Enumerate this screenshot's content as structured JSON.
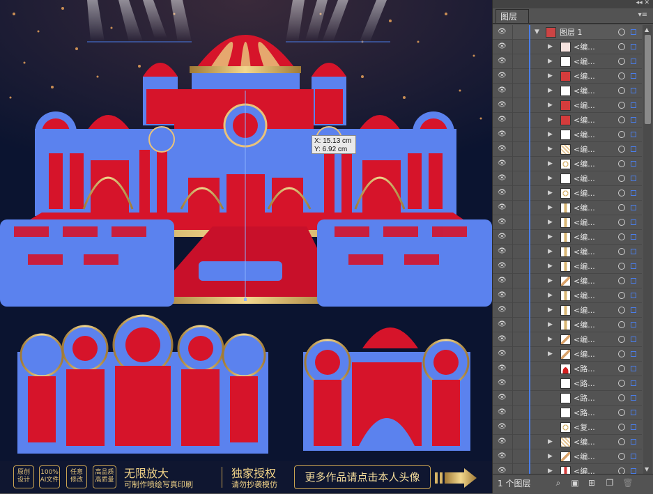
{
  "tooltip": {
    "x": "X: 15.13 cm",
    "y": "Y: 6.92 cm"
  },
  "banner": {
    "badges": [
      {
        "line1": "原创",
        "line2": "设计"
      },
      {
        "line1": "100%",
        "line2": "AI文件"
      },
      {
        "line1": "任意",
        "line2": "修改"
      },
      {
        "line1": "高品质",
        "line2": "高质量"
      }
    ],
    "zoom_title": "无限放大",
    "zoom_sub": "可制作喷绘写真印刷",
    "license_title": "独家授权",
    "license_sub": "请勿抄袭模仿",
    "more": "更多作品请点击本人头像",
    "arrow": "arrow-right-icon"
  },
  "panel": {
    "top_controls": "◂◂ ✕",
    "tab_label": "图层",
    "menu_glyph": "▾≡",
    "top_layer": "图层 1",
    "rows": [
      {
        "name": "<编...",
        "thumb": "rect-red"
      },
      {
        "name": "<编...",
        "thumb": "rect"
      },
      {
        "name": "<编...",
        "thumb": "red"
      },
      {
        "name": "<编...",
        "thumb": "rect"
      },
      {
        "name": "<编...",
        "thumb": "red"
      },
      {
        "name": "<编...",
        "thumb": "red"
      },
      {
        "name": "<编...",
        "thumb": "rect"
      },
      {
        "name": "<编...",
        "thumb": "pattern"
      },
      {
        "name": "<编...",
        "thumb": "circle"
      },
      {
        "name": "<编...",
        "thumb": "rect"
      },
      {
        "name": "<编...",
        "thumb": "circle"
      },
      {
        "name": "<编...",
        "thumb": "pillar"
      },
      {
        "name": "<编...",
        "thumb": "pillar"
      },
      {
        "name": "<编...",
        "thumb": "pillar"
      },
      {
        "name": "<编...",
        "thumb": "pillar"
      },
      {
        "name": "<编...",
        "thumb": "pillar"
      },
      {
        "name": "<编...",
        "thumb": "diag"
      },
      {
        "name": "<编...",
        "thumb": "pillar"
      },
      {
        "name": "<编...",
        "thumb": "pillar"
      },
      {
        "name": "<编...",
        "thumb": "pillar"
      },
      {
        "name": "<编...",
        "thumb": "diag"
      },
      {
        "name": "<编...",
        "thumb": "diag"
      },
      {
        "name": "<路...",
        "thumb": "dome-red"
      },
      {
        "name": "<路...",
        "thumb": "blank"
      },
      {
        "name": "<路...",
        "thumb": "blank"
      },
      {
        "name": "<路...",
        "thumb": "blank"
      },
      {
        "name": "<复...",
        "thumb": "circle"
      },
      {
        "name": "<编...",
        "thumb": "pattern"
      },
      {
        "name": "<编...",
        "thumb": "diag"
      },
      {
        "name": "<编...",
        "thumb": "pillar-red"
      },
      {
        "name": "<编...",
        "thumb": "pillar"
      }
    ],
    "layer_count": "1 个图层",
    "bottom_icons": [
      "search-icon",
      "clipping-icon",
      "new-sublayer-icon",
      "new-layer-icon",
      "delete-icon"
    ]
  }
}
